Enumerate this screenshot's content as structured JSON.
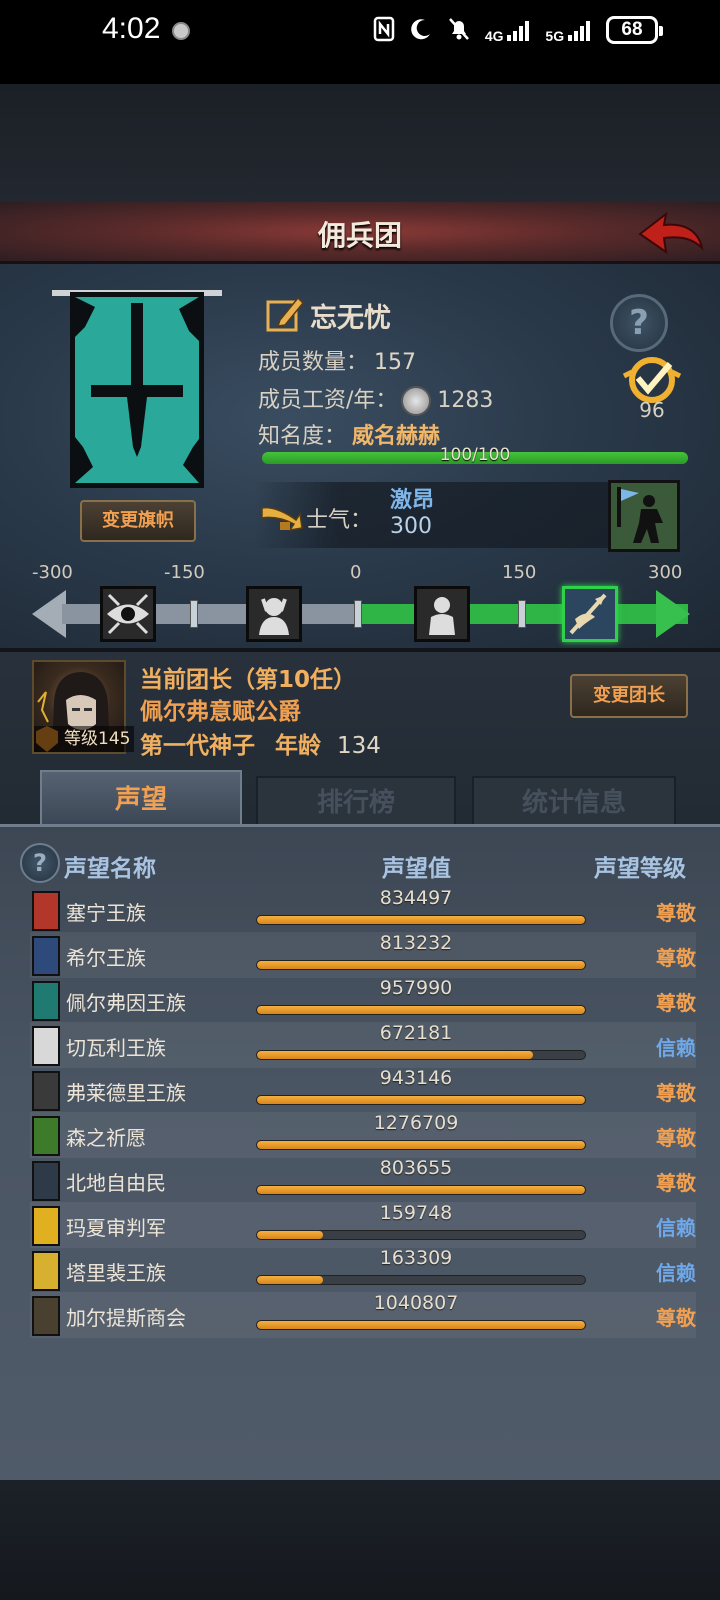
{
  "status_bar": {
    "time": "4:02",
    "battery": "68",
    "network1": "4G",
    "network2": "5G"
  },
  "header": {
    "title": "佣兵团"
  },
  "guild": {
    "name": "忘无忧",
    "members_label": "成员数量：",
    "members_value": "157",
    "wage_label": "成员工资/年：",
    "wage_value": "1283",
    "fame_label": "知名度：",
    "fame_value": "威名赫赫",
    "fame_progress_text": "100/100",
    "fame_progress": 1.0,
    "rank_number": "96",
    "change_banner_label": "变更旗帜",
    "morale_label": "士气：",
    "morale_word": "激昂",
    "morale_value": "300",
    "banner_color": "#2aa89a"
  },
  "morale_scale": {
    "labels": [
      "-300",
      "-150",
      "0",
      "150",
      "300"
    ],
    "current": 300
  },
  "leader": {
    "title": "当前团长（第10任）",
    "name": "佩尔弗意赋公爵",
    "level_text": "等级145",
    "generation": "第一代神子",
    "age_label": "年龄",
    "age_value": "134",
    "change_leader_label": "变更团长"
  },
  "tabs": [
    {
      "label": "声望",
      "active": true
    },
    {
      "label": "排行榜",
      "active": false
    },
    {
      "label": "统计信息",
      "active": false
    }
  ],
  "reputation": {
    "header_name": "声望名称",
    "header_value": "声望值",
    "header_level": "声望等级",
    "rows": [
      {
        "name": "塞宁王族",
        "value": "834497",
        "fill": 1.0,
        "level": "尊敬",
        "level_color": "#f0a050",
        "icon_color": "#b3362a"
      },
      {
        "name": "希尔王族",
        "value": "813232",
        "fill": 1.0,
        "level": "尊敬",
        "level_color": "#f0a050",
        "icon_color": "#2d4a7a"
      },
      {
        "name": "佩尔弗因王族",
        "value": "957990",
        "fill": 1.0,
        "level": "尊敬",
        "level_color": "#f0a050",
        "icon_color": "#1f7a72"
      },
      {
        "name": "切瓦利王族",
        "value": "672181",
        "fill": 0.84,
        "level": "信赖",
        "level_color": "#6fa8e8",
        "icon_color": "#d8d8d8"
      },
      {
        "name": "弗莱德里王族",
        "value": "943146",
        "fill": 1.0,
        "level": "尊敬",
        "level_color": "#f0a050",
        "icon_color": "#3a3a3a"
      },
      {
        "name": "森之祈愿",
        "value": "1276709",
        "fill": 1.0,
        "level": "尊敬",
        "level_color": "#f0a050",
        "icon_color": "#3d7a2a"
      },
      {
        "name": "北地自由民",
        "value": "803655",
        "fill": 1.0,
        "level": "尊敬",
        "level_color": "#f0a050",
        "icon_color": "#2f3a48"
      },
      {
        "name": "玛夏审判军",
        "value": "159748",
        "fill": 0.2,
        "level": "信赖",
        "level_color": "#6fa8e8",
        "icon_color": "#e0b020"
      },
      {
        "name": "塔里裴王族",
        "value": "163309",
        "fill": 0.2,
        "level": "信赖",
        "level_color": "#6fa8e8",
        "icon_color": "#d8b030"
      },
      {
        "name": "加尔提斯商会",
        "value": "1040807",
        "fill": 1.0,
        "level": "尊敬",
        "level_color": "#f0a050",
        "icon_color": "#4a4030"
      }
    ]
  }
}
